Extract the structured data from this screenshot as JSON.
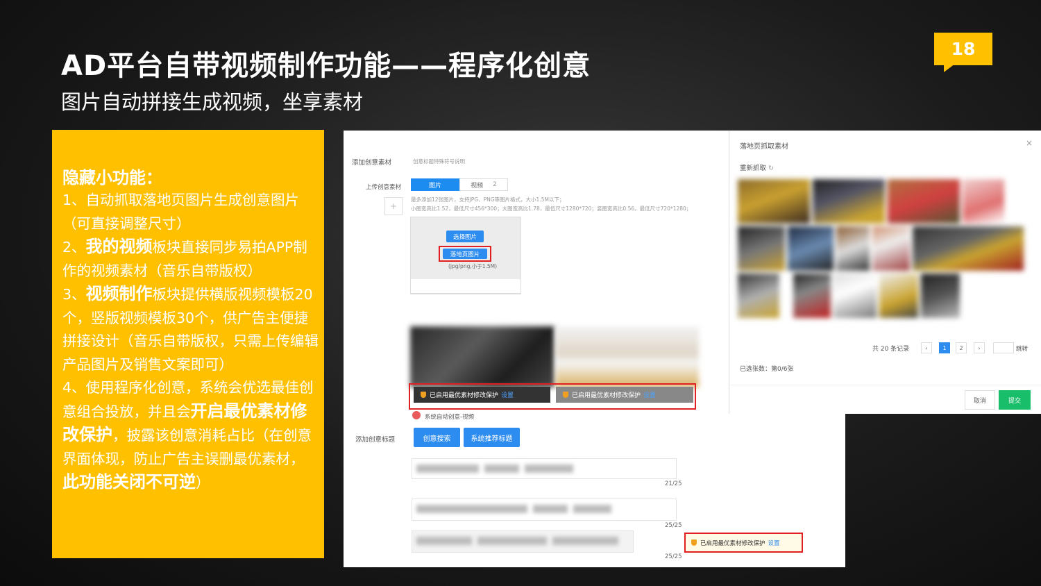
{
  "slide": {
    "title": "AD平台自带视频制作功能——程序化创意",
    "subtitle": "图片自动拼接生成视频，坐享素材",
    "page_number": "18"
  },
  "panel": {
    "heading": "隐藏小功能：",
    "item1": "1、自动抓取落地页图片生成创意图片（可直接调整尺寸）",
    "item2_prefix": "2、",
    "item2_bold": "我的视频",
    "item2_rest": "板块直接同步易拍APP制作的视频素材（音乐自带版权）",
    "item3_prefix": "3、",
    "item3_bold": "视频制作",
    "item3_rest": "板块提供横版视频模板20个，竖版视频模板30个，供广告主便捷拼接设计（音乐自带版权，只需上传编辑产品图片及销售文案即可）",
    "item4_a": "4、使用程序化创意，系统会优选最佳创意组合投放，并且会",
    "item4_bold1": "开启最优素材修改保护",
    "item4_b": "，披露该创意消耗占比（在创意界面体现，防止广告主误删最优素材，",
    "item4_bold2": "此功能关闭不可逆",
    "item4_c": "）"
  },
  "screenshot": {
    "add_material_label": "添加创意素材",
    "add_material_hint": "创意标题特殊符号说明",
    "upload_label": "上传创意素材",
    "tab_image": "图片",
    "tab_video": "视频",
    "tab_video_count": "2",
    "upload_hint_1": "最多添加12张图片，支持JPG、PNG等图片格式，大小1.5M以下；",
    "upload_hint_2": "小图宽高比1.52，最低尺寸456*300；大图宽高比1.78，最低尺寸1280*720；竖图宽高比0.56，最低尺寸720*1280；",
    "plus": "+",
    "select_image_btn": "选择图片",
    "landing_image_btn": "落地页图片",
    "format_hint": "(jpg/png,小于1.5M)",
    "protect_text": "已启用最优素材修改保护",
    "protect_link": "设置",
    "auto_creative": "系统自动创意-视频",
    "add_title_label": "添加创意标题",
    "creative_search_btn": "创意搜索",
    "recommend_title_btn": "系统推荐标题",
    "count1": "21/25",
    "count2": "25/25",
    "count3": "25/25"
  },
  "dialog": {
    "title": "落地页抓取素材",
    "close": "×",
    "refetch": "重新抓取",
    "total": "共 20 条记录",
    "prev": "‹",
    "page1": "1",
    "page2": "2",
    "next": "›",
    "jump": "跳转",
    "selected": "已选张数：第0/6张",
    "cancel": "取消",
    "submit": "提交"
  },
  "colors": {
    "accent_yellow": "#ffc000",
    "primary_blue": "#2d8cf0",
    "submit_green": "#19be6b",
    "highlight_red": "#e02020"
  }
}
